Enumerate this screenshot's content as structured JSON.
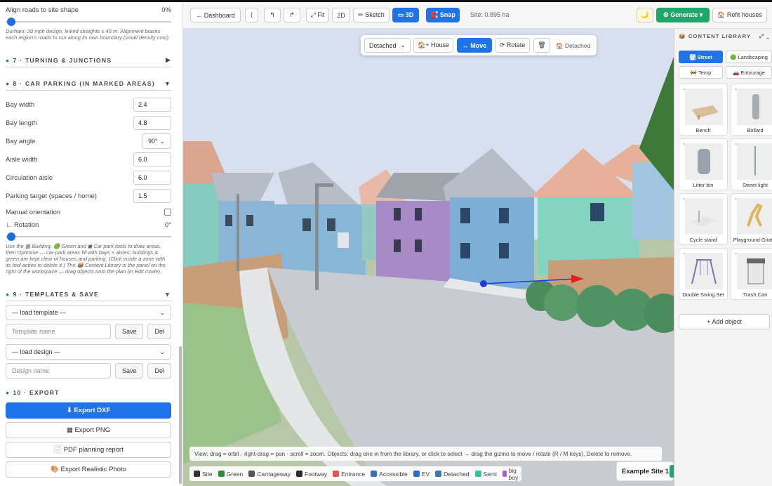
{
  "sidebar": {
    "align_label": "Align roads to site shape",
    "align_value": "0%",
    "align_note": "Durham: 20 mph design, linked straights ≤ 45 m. Alignment biases each region's roads to run along its own boundary (small density cost).",
    "sections": {
      "turning": {
        "num": "7",
        "title": "TURNING & JUNCTIONS",
        "arrow": "▶"
      },
      "parking": {
        "num": "8",
        "title": "CAR PARKING (IN MARKED AREAS)",
        "arrow": "▼"
      },
      "templates": {
        "num": "9",
        "title": "TEMPLATES & SAVE",
        "arrow": "▼"
      },
      "export": {
        "num": "10",
        "title": "EXPORT"
      }
    },
    "parking": {
      "bay_width_label": "Bay width",
      "bay_width": "2.4",
      "bay_length_label": "Bay length",
      "bay_length": "4.8",
      "bay_angle_label": "Bay angle",
      "bay_angle": "90°",
      "aisle_width_label": "Aisle width",
      "aisle_width": "6.0",
      "circ_aisle_label": "Circulation aisle",
      "circ_aisle": "6.0",
      "target_label": "Parking target (spaces / home)",
      "target": "1.5",
      "manual_label": "Manual orientation",
      "rotation_label": "∟ Rotation",
      "rotation_value": "0°",
      "note": "Use the ▦ Building, 🟢 Green and ◼ Car park tools to draw areas, then Optimise — car-park areas fill with bays + aisles; buildings & green are kept clear of houses and parking. (Click inside a zone with its tool active to delete it.) The 📦 Content Library is the panel on the right of the workspace — drag objects onto the plan (in Edit mode)."
    },
    "templates": {
      "load_template": "— load template —",
      "template_placeholder": "Template name",
      "load_design": "— load design —",
      "design_placeholder": "Design name",
      "save": "Save",
      "del": "Del"
    },
    "export": {
      "dxf": "⬇ Export DXF",
      "png": "▦ Export PNG",
      "pdf": "📄 PDF planning report",
      "photo": "🎨 Export Realistic Photo"
    }
  },
  "toolbar": {
    "dashboard": "← Dashboard",
    "collapse": "⟨",
    "undo": "↰",
    "redo": "↱",
    "fit": "⤢ Fit",
    "view2d": "2D",
    "sketch": "✏ Sketch",
    "view3d": "▭ 3D",
    "snap": "🧲 Snap",
    "site": "Site: 0.895 ha",
    "theme": "🌙",
    "generate": "⚙ Generate ▾",
    "refit": "🏠 Refit houses"
  },
  "float_bar": {
    "type": "Detached",
    "house": "🏠+ House",
    "move": "↔ Move",
    "rotate": "⟳ Rotate",
    "delete": "🗑",
    "status": "🏠 Detached"
  },
  "hint": "View: drag = orbit · right-drag = pan · scroll = zoom. Objects: drag one in from the library, or click to select → drag the gizmo to move / rotate (R / M keys), Delete to remove.",
  "legend": [
    {
      "label": "Site",
      "color": "#333333"
    },
    {
      "label": "Green",
      "color": "#2e8b3e"
    },
    {
      "label": "Carriageway",
      "color": "#555555"
    },
    {
      "label": "Footway",
      "color": "#2b2b2b"
    },
    {
      "label": "Entrance",
      "color": "#e05555"
    },
    {
      "label": "Accessible",
      "color": "#3a6fb0"
    },
    {
      "label": "EV",
      "color": "#2a6fd0"
    },
    {
      "label": "Detached",
      "color": "#3a78b5"
    },
    {
      "label": "Semi",
      "color": "#2cc8a0"
    },
    {
      "label": "big boy",
      "color": "#b060d0"
    }
  ],
  "site_badge": "Example Site 1",
  "library": {
    "title": "📦 CONTENT LIBRARY",
    "icons": "⤢ ⌄",
    "tabs": [
      "🛣 Street",
      "🟢 Landscaping",
      "🚧 Temp",
      "🚗 Entourage"
    ],
    "items": [
      "Bench",
      "Bollard",
      "Litter bin",
      "Street light",
      "Cycle stand",
      "Playground Giraffe",
      "Double Swing Set",
      "Trash Can"
    ],
    "add": "+ Add object"
  }
}
